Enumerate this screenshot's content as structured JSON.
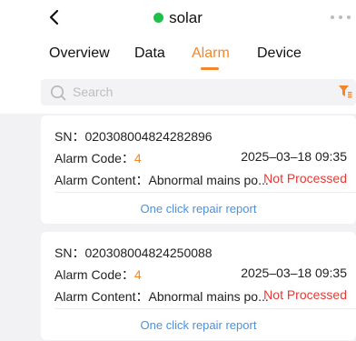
{
  "header": {
    "title": "solar",
    "status_color": "#1fbf4a",
    "back_icon": "chevron-left-icon",
    "more_icon": "more-dots-icon"
  },
  "tabs": [
    {
      "label": "Overview",
      "active": false
    },
    {
      "label": "Data",
      "active": false
    },
    {
      "label": "Alarm",
      "active": true
    },
    {
      "label": "Device",
      "active": false
    }
  ],
  "accent_color": "#f4862a",
  "search": {
    "placeholder": "Search",
    "icon": "search-icon",
    "filter_icon": "filter-icon"
  },
  "alarms": [
    {
      "sn": "SN：020308004824282896",
      "code_label": "Alarm Code：",
      "code": "4",
      "time": "2025–03–18 09:35",
      "content": "Alarm Content：Abnormal mains po...",
      "status": "Not Processed",
      "action": "One click repair report"
    },
    {
      "sn": "SN：020308004824250088",
      "code_label": "Alarm Code：",
      "code": "4",
      "time": "2025–03–18 09:35",
      "content": "Alarm Content：Abnormal mains po...",
      "status": "Not Processed",
      "action": "One click repair report"
    }
  ]
}
